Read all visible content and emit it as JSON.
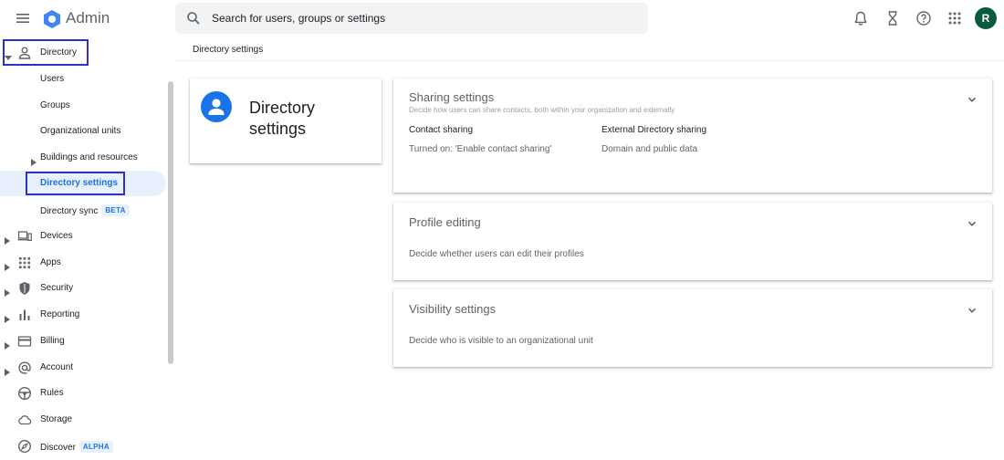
{
  "header": {
    "app_title": "Admin",
    "search_placeholder": "Search for users, groups or settings",
    "avatar_initial": "R"
  },
  "sidebar": {
    "directory": "Directory",
    "users": "Users",
    "groups": "Groups",
    "org_units": "Organizational units",
    "buildings": "Buildings and resources",
    "directory_settings": "Directory settings",
    "directory_sync": "Directory sync",
    "directory_sync_badge": "BETA",
    "devices": "Devices",
    "apps": "Apps",
    "security": "Security",
    "reporting": "Reporting",
    "billing": "Billing",
    "account": "Account",
    "rules": "Rules",
    "storage": "Storage",
    "discover": "Discover",
    "discover_badge": "ALPHA"
  },
  "main": {
    "breadcrumb": "Directory settings",
    "title_card": {
      "title": "Directory settings"
    },
    "sharing": {
      "title": "Sharing settings",
      "subtitle": "Decide how users can share contacts, both within your organization and externally",
      "contact_title": "Contact sharing",
      "contact_value": "Turned on: 'Enable contact sharing'",
      "external_title": "External Directory sharing",
      "external_value": "Domain and public data"
    },
    "profile": {
      "title": "Profile editing",
      "description": "Decide whether users can edit their profiles"
    },
    "visibility": {
      "title": "Visibility settings",
      "description": "Decide who is visible to an organizational unit"
    }
  },
  "colors": {
    "accent": "#1a73e8",
    "highlight_box": "#2c33c4",
    "avatar_bg": "#0b5a3e"
  }
}
